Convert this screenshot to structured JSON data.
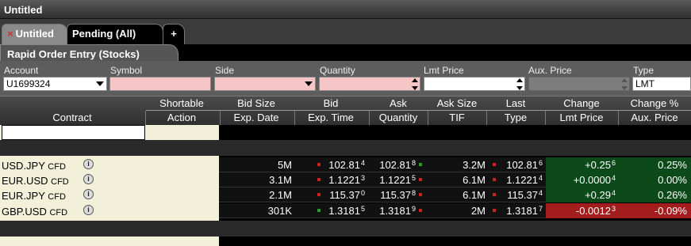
{
  "window": {
    "title": "Untitled"
  },
  "tabs": [
    {
      "label": "Untitled",
      "active": true,
      "close": "×"
    },
    {
      "label": "Pending (All)",
      "active": false
    },
    {
      "label": "+",
      "active": false
    }
  ],
  "panel": {
    "title": "Rapid Order Entry (Stocks)"
  },
  "entry": {
    "account_label": "Account",
    "account_value": "U1699324",
    "symbol_label": "Symbol",
    "symbol_value": "",
    "side_label": "Side",
    "side_value": "",
    "quantity_label": "Quantity",
    "quantity_value": "",
    "lmt_label": "Lmt Price",
    "lmt_value": "",
    "aux_label": "Aux. Price",
    "aux_value": "",
    "type_label": "Type",
    "type_value": "LMT"
  },
  "columns": {
    "contract": "Contract",
    "top": [
      "Shortable",
      "Bid Size",
      "Bid",
      "Ask",
      "Ask Size",
      "Last",
      "Change",
      "Change %"
    ],
    "bottom": [
      "Action",
      "Exp. Date",
      "Exp. Time",
      "Quantity",
      "TIF",
      "Type",
      "Lmt Price",
      "Aux. Price"
    ]
  },
  "rows": [
    {
      "sym": "USD.JPY",
      "cfd": "CFD",
      "bid_size": "5M",
      "bid_tick": "down",
      "bid": "102.81",
      "bid_sup": "4",
      "ask": "102.81",
      "ask_sup": "8",
      "ask_tick": "up",
      "ask_size": "3.2M",
      "last_tick": "down",
      "last": "102.81",
      "last_sup": "6",
      "change": "+0.25",
      "change_sup": "6",
      "change_dir": "up",
      "change_pct": "0.25%"
    },
    {
      "sym": "EUR.USD",
      "cfd": "CFD",
      "bid_size": "3.1M",
      "bid_tick": "down",
      "bid": "1.1221",
      "bid_sup": "3",
      "ask": "1.1221",
      "ask_sup": "5",
      "ask_tick": "down",
      "ask_size": "6.1M",
      "last_tick": "down",
      "last": "1.1221",
      "last_sup": "4",
      "change": "+0.0000",
      "change_sup": "4",
      "change_dir": "up",
      "change_pct": "0.00%"
    },
    {
      "sym": "EUR.JPY",
      "cfd": "CFD",
      "bid_size": "2.1M",
      "bid_tick": "down",
      "bid": "115.37",
      "bid_sup": "0",
      "ask": "115.37",
      "ask_sup": "8",
      "ask_tick": "down",
      "ask_size": "6.1M",
      "last_tick": "down",
      "last": "115.37",
      "last_sup": "4",
      "change": "+0.29",
      "change_sup": "4",
      "change_dir": "up",
      "change_pct": "0.26%"
    },
    {
      "sym": "GBP.USD",
      "cfd": "CFD",
      "bid_size": "301K",
      "bid_tick": "up",
      "bid": "1.3181",
      "bid_sup": "5",
      "ask": "1.3181",
      "ask_sup": "9",
      "ask_tick": "down",
      "ask_size": "2M",
      "last_tick": "down",
      "last": "1.3181",
      "last_sup": "7",
      "change": "-0.0012",
      "change_sup": "3",
      "change_dir": "down",
      "change_pct": "-0.09%"
    }
  ],
  "colors": {
    "tick_up": "#2e9b2e",
    "tick_down": "#d02020",
    "change_up_bg": "#0c4a1a",
    "change_down_bg": "#a31d1d"
  },
  "icons": {
    "info": "info-circle-icon",
    "close": "close-icon",
    "dropdown": "chevron-down-icon",
    "spinner": "spinner-arrows-icon"
  }
}
